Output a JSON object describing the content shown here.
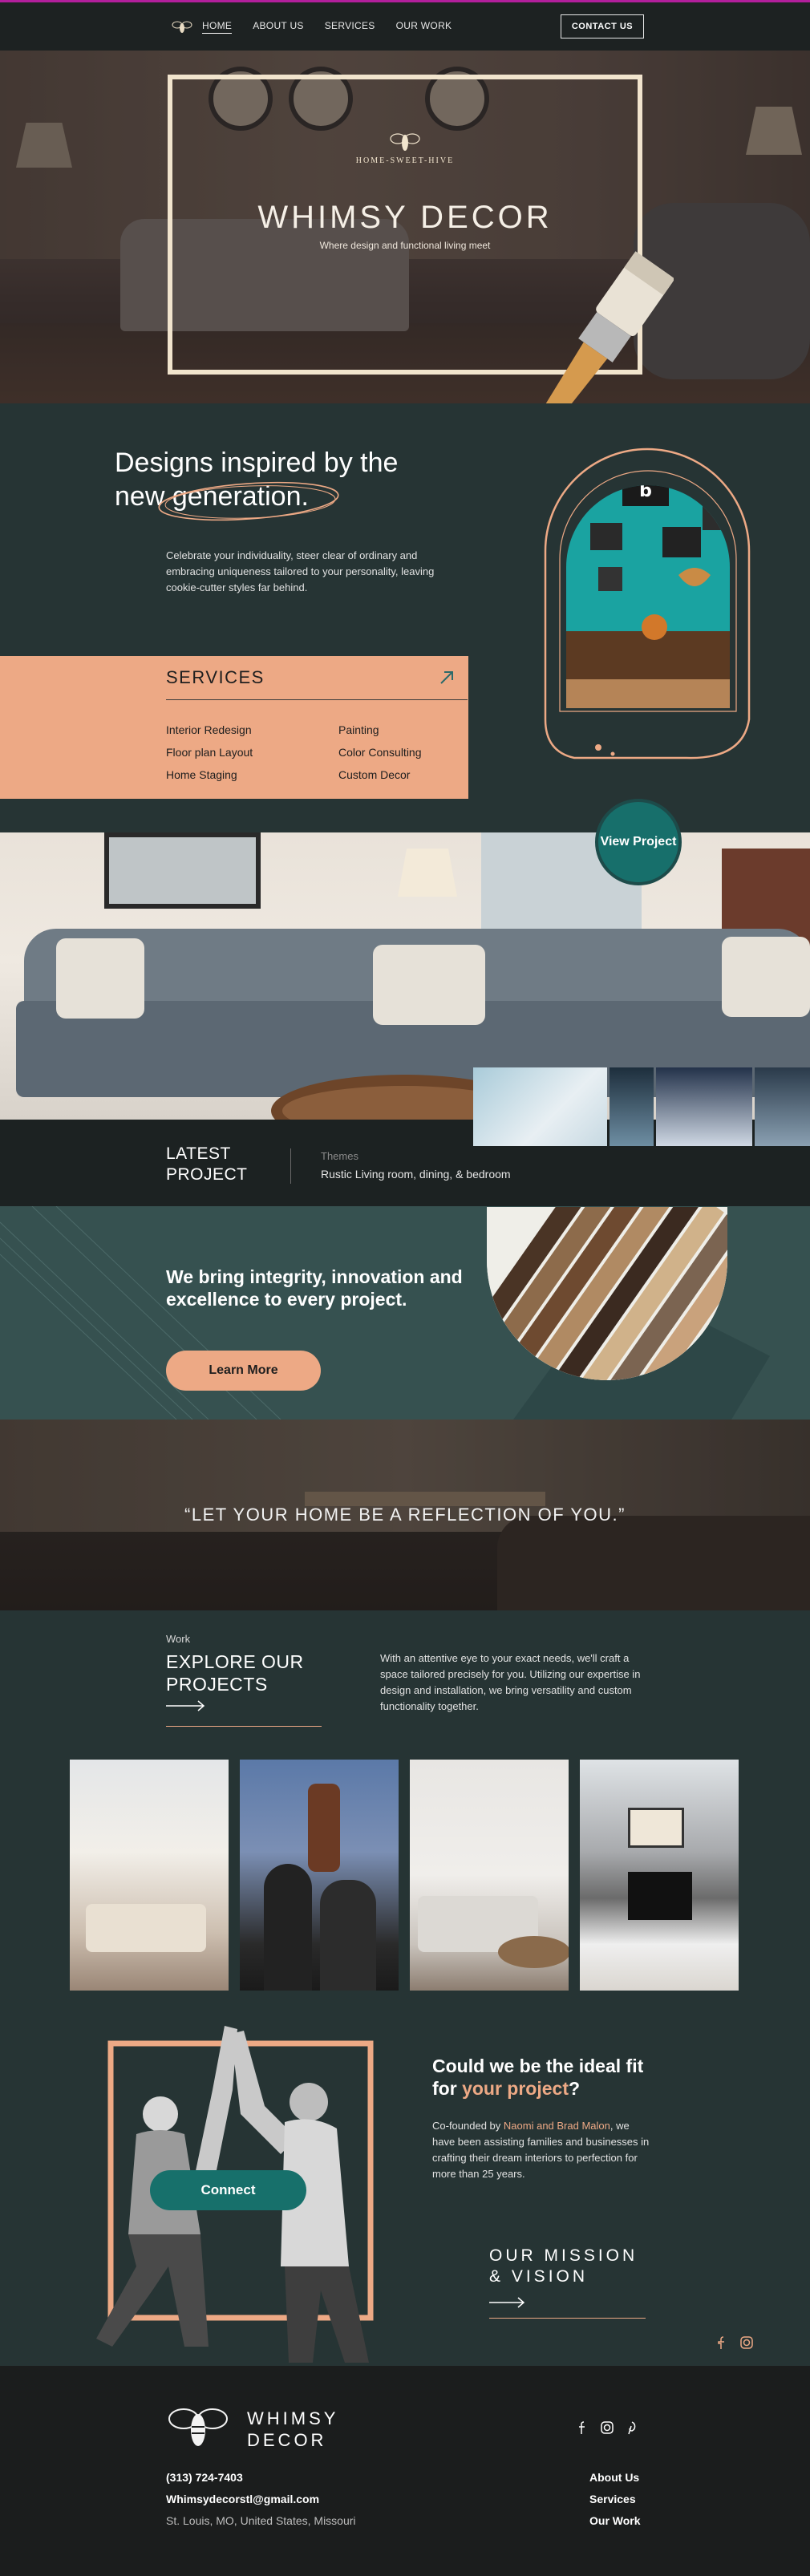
{
  "colors": {
    "accent_peach": "#eda985",
    "teal_button": "#17706b",
    "dark_teal_bg": "#263434",
    "nav_bg": "#1d2222",
    "top_line": "#b21f9c"
  },
  "nav": {
    "logo_icon": "bee-icon",
    "links": [
      "HOME",
      "ABOUT US",
      "SERVICES",
      "OUR WORK"
    ],
    "active": "HOME",
    "contact_label": "CONTACT US"
  },
  "hero": {
    "brand_small": "HOME-SWEET-HIVE",
    "title": "WHIMSY DECOR",
    "tagline": "Where design and functional living meet",
    "brush_icon": "paintbrush-icon"
  },
  "intro": {
    "title_line1": "Designs inspired by the",
    "title_line2": "new generation.",
    "body": "Celebrate your individuality, steer clear of ordinary and embracing uniqueness tailored to your personality, leaving cookie-cutter styles far behind."
  },
  "services": {
    "title": "SERVICES",
    "arrow_icon": "arrow-up-right-icon",
    "col1": [
      "Interior Redesign",
      "Floor plan Layout",
      "Home Staging"
    ],
    "col2": [
      "Painting",
      "Color Consulting",
      "Custom Decor"
    ]
  },
  "view_project": {
    "label": "View Project"
  },
  "latest": {
    "label_line1": "LATEST",
    "label_line2": "PROJECT",
    "themes_label": "Themes",
    "description": "Rustic Living room, dining, & bedroom"
  },
  "integrity": {
    "heading": "We bring integrity, innovation and excellence to every project.",
    "button": "Learn More"
  },
  "quote": {
    "text": "“LET YOUR HOME BE A REFLECTION OF YOU.”"
  },
  "work": {
    "eyebrow": "Work",
    "title_line1": "EXPLORE OUR",
    "title_line2": "PROJECTS",
    "body": "With an attentive eye to your exact needs, we'll craft a space tailored precisely for you. Utilizing our expertise in design and installation, we bring versatility and custom functionality together."
  },
  "connect": {
    "button": "Connect",
    "title_part1": "Could we be the ideal fit for ",
    "title_accent": "your project",
    "title_part2": "?",
    "body_part1": "Co-founded by ",
    "body_accent": "Naomi and Brad Malon",
    "body_part2": ", we have been assisting families and businesses in crafting their dream interiors to perfection for more than 25 years.",
    "mission_line1": "OUR MISSION",
    "mission_line2": "& VISION"
  },
  "footer": {
    "brand_line1": "WHIMSY",
    "brand_line2": "DECOR",
    "phone": "(313) 724-7403",
    "email": "Whimsydecorstl@gmail.com",
    "address": "St. Louis, MO, United States, Missouri",
    "links": [
      "About Us",
      "Services",
      "Our Work"
    ],
    "social_icons": [
      "facebook-icon",
      "instagram-icon",
      "pinterest-icon"
    ]
  }
}
